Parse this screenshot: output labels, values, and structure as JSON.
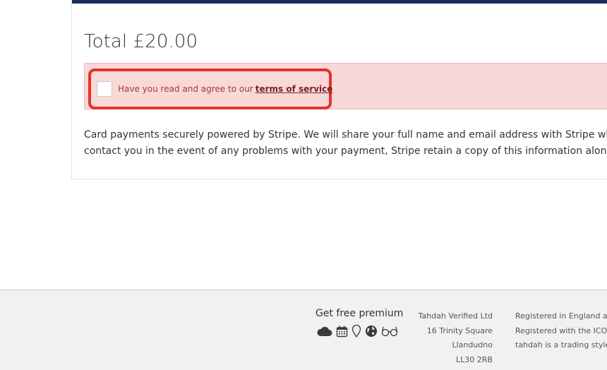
{
  "checkout": {
    "total": "Total £20.00",
    "terms": {
      "prefix": "Have you read and agree to our",
      "link": "terms of service",
      "checked": false
    },
    "stripe_note_line1": "Card payments securely powered by Stripe. We will share your full name and email address with Stripe when m",
    "stripe_note_line2": "contact you in the event of any problems with your payment, Stripe retain a copy of this information along wit"
  },
  "footer": {
    "premium_title": "Get free premium",
    "premium_icons": [
      "cloud-icon",
      "calendar-icon",
      "map-pin-icon",
      "globe-icon",
      "glasses-icon"
    ],
    "address": [
      "Tahdah Verified Ltd",
      "16 Trinity Square",
      "Llandudno",
      "LL30 2RB"
    ],
    "legal": [
      "Registered in England ar",
      "Registered with the ICO",
      "tahdah is a trading style"
    ]
  },
  "colors": {
    "card_topbar": "#1a2a5c",
    "alert_background": "#f9d8d8",
    "highlight_border": "#e2342b",
    "terms_link": "#7a2323",
    "footer_background": "#f1f1f1"
  }
}
